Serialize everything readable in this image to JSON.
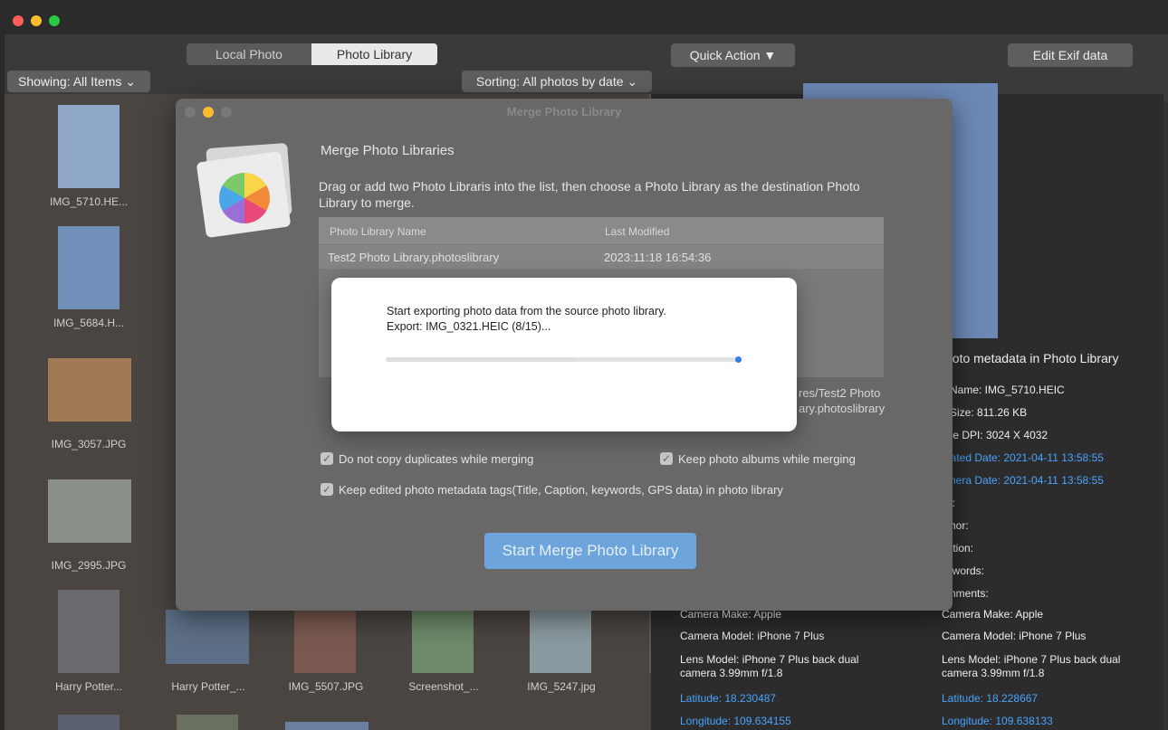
{
  "toolbar": {
    "tab_local": "Local Photo",
    "tab_library": "Photo Library",
    "quick_action": "Quick Action ▼",
    "edit_exif": "Edit Exif data",
    "showing": "Showing: All Items ⌄",
    "sorting": "Sorting: All photos by date ⌄"
  },
  "thumbnails": [
    {
      "label": "IMG_5710.HE...",
      "color": "#8fa7c8"
    },
    {
      "label": "IMG_5684.H...",
      "color": "#6f8fb8"
    },
    {
      "label": "IMG_3057.JPG",
      "color": "#a07a55"
    },
    {
      "label": "IMG_2995.JPG",
      "color": "#8a8f88"
    },
    {
      "label": "Harry Potter...",
      "color": "#6a6a70"
    }
  ],
  "bottom_row": [
    {
      "label": "Harry Potter_...",
      "color": "#5d6f86"
    },
    {
      "label": "IMG_5507.JPG",
      "color": "#7a5a50"
    },
    {
      "label": "Screenshot_...",
      "color": "#6e8a6a"
    },
    {
      "label": "IMG_5247.jpg",
      "color": "#8a9aa0"
    }
  ],
  "right_meta": {
    "heading": "hoto metadata in Photo Library",
    "file_name": "e Name: IMG_5710.HEIC",
    "file_size": "e Size: 811.26 KB",
    "dpi": "age DPI: 3024 X 4032",
    "created": "reated Date: 2021-04-11 13:58:55",
    "camera_date": "amera Date: 2021-04-11 13:58:55",
    "title": "tle:",
    "author": "uthor:",
    "caption": "aption:",
    "keywords": "eywords:",
    "comments": "omments:",
    "make_l": "Camera Make: Apple",
    "make_r": "Camera Make: Apple",
    "model_l": "Camera Model: iPhone 7 Plus",
    "model_r": "Camera Model: iPhone 7 Plus",
    "lens_l1": "Lens Model: iPhone 7 Plus back dual",
    "lens_l2": "camera 3.99mm f/1.8",
    "lens_r1": "Lens Model: iPhone 7 Plus back dual",
    "lens_r2": "camera 3.99mm f/1.8",
    "lat_l": "Latitude: 18.230487",
    "lat_r": "Latitude: 18.228667",
    "lon_l": "Longitude: 109.634155",
    "lon_r": "Longitude: 109.638133"
  },
  "sheet": {
    "title": "Merge Photo Library",
    "heading": "Merge Photo Libraries",
    "desc1": "Drag or add two Photo Libraris into the list, then choose a Photo Library as the destination Photo",
    "desc2": "Library to merge.",
    "col_name": "Photo Library Name",
    "col_modified": "Last Modified",
    "row1_name": "Test2 Photo Library.photoslibrary",
    "row1_date": "2023:11:18 16:54:36",
    "path1": "res/Test2 Photo",
    "path2": "ary.photoslibrary",
    "opt1": "Do not copy duplicates while merging",
    "opt2": "Keep photo albums while merging",
    "opt3": "Keep edited photo metadata tags(Title, Caption, keywords, GPS data) in photo library",
    "start_button": "Start Merge Photo Library"
  },
  "progress": {
    "line1": "Start exporting photo data from the source photo library.",
    "line2": "Export: IMG_0321.HEIC   (8/15)...",
    "fraction": 0.533
  },
  "colors": {
    "accent": "#2f7ee6",
    "link": "#4aa3ff",
    "start_button": "#6ea4dc"
  }
}
